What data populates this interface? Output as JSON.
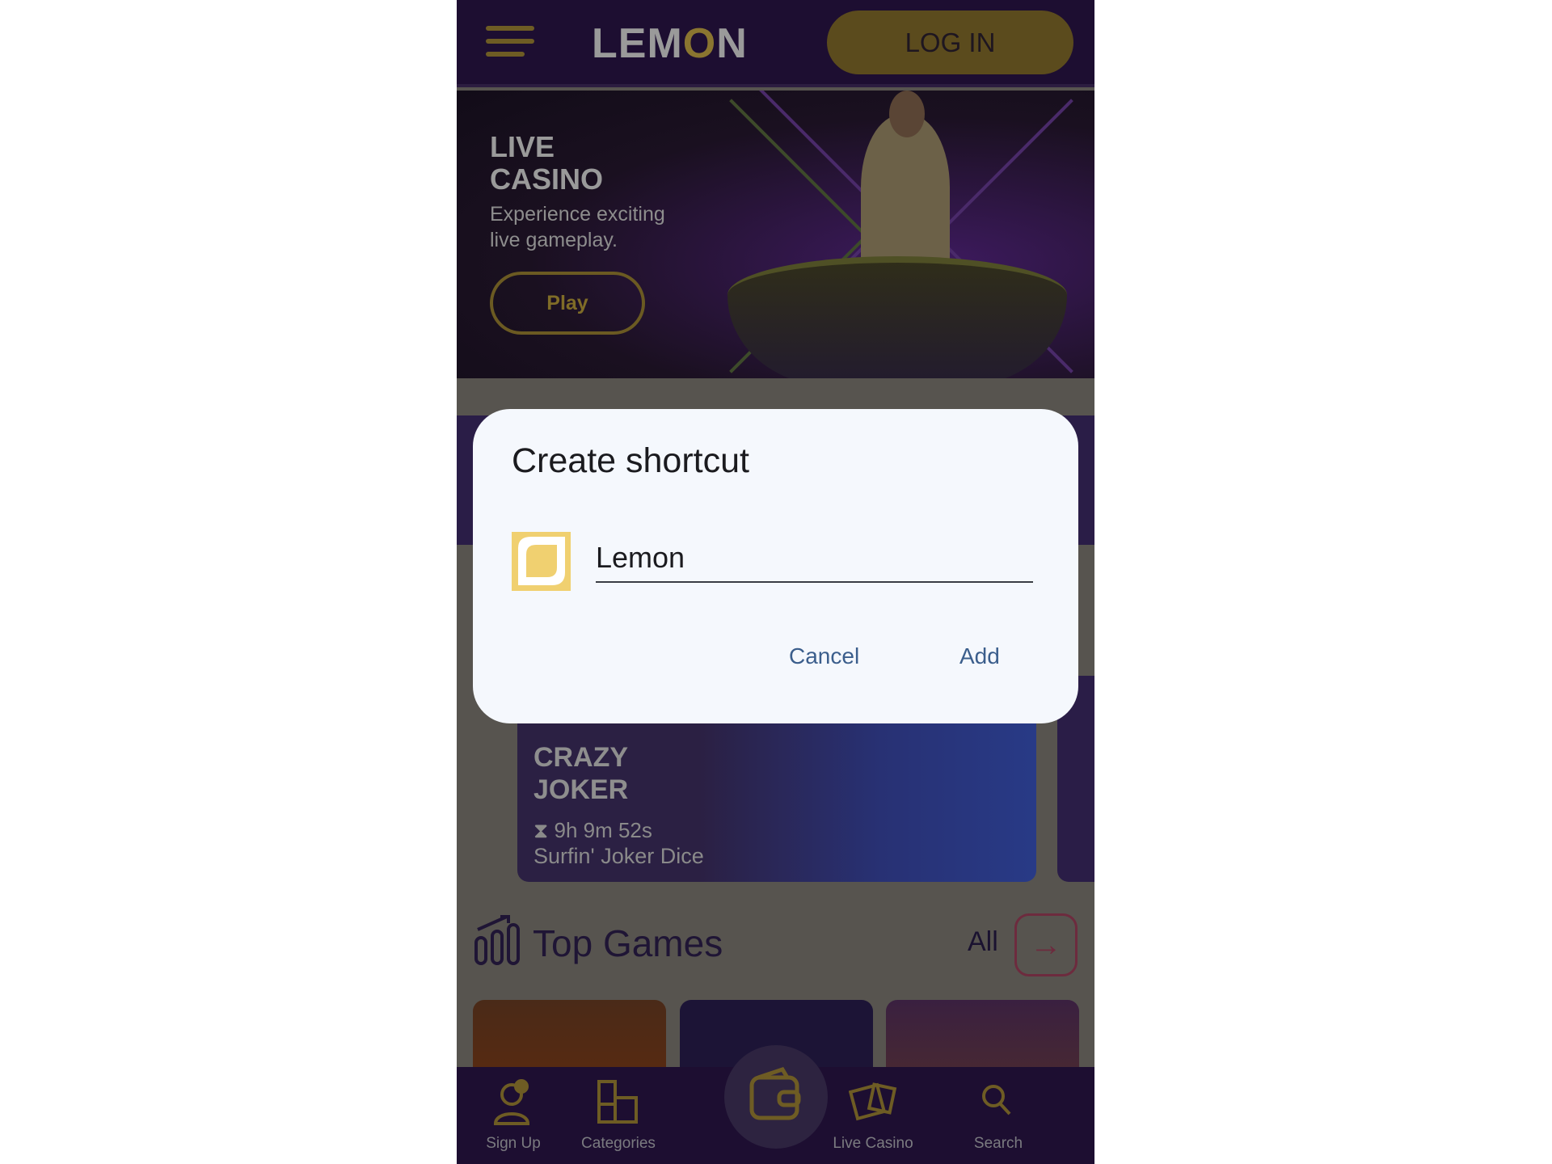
{
  "header": {
    "logo_pre": "LEM",
    "logo_o": "O",
    "logo_post": "N",
    "login": "LOG IN"
  },
  "hero": {
    "title_line1": "LIVE",
    "title_line2": "CASINO",
    "subtitle": "Experience exciting live gameplay.",
    "play": "Play"
  },
  "tournament": {
    "title_line1": "CRAZY",
    "title_line2": "JOKER",
    "timer": "9h 9m 52s",
    "game": "Surfin' Joker Dice"
  },
  "top_games": {
    "title": "Top Games",
    "all": "All"
  },
  "nav": [
    {
      "label": "Sign Up",
      "icon": "user-icon"
    },
    {
      "label": "Categories",
      "icon": "grid-icon"
    },
    {
      "label": "",
      "icon": "wallet-icon"
    },
    {
      "label": "Live Casino",
      "icon": "dice-icon"
    },
    {
      "label": "Search",
      "icon": "search-icon"
    }
  ],
  "dialog": {
    "title": "Create shortcut",
    "name_value": "Lemon",
    "cancel": "Cancel",
    "add": "Add"
  },
  "colors": {
    "accent": "#f0d070",
    "dialog_button": "#3b5e8c",
    "header": "#1d0e31"
  }
}
